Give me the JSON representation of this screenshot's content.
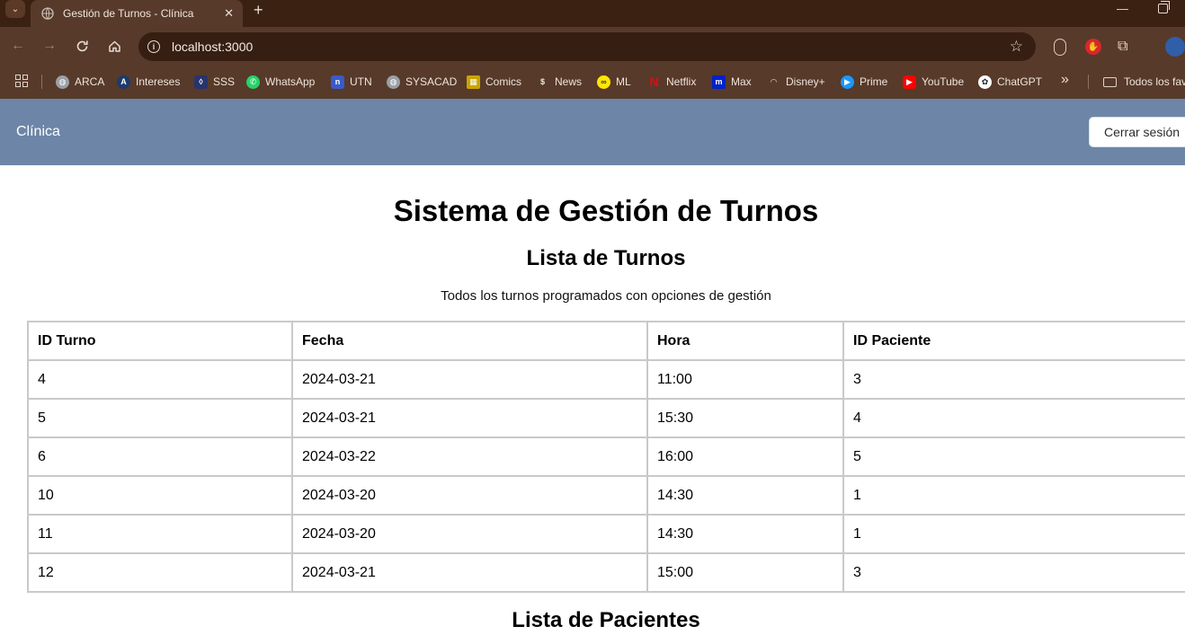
{
  "browser": {
    "tab_title": "Gestión de Turnos - Clínica",
    "url": "localhost:3000",
    "bookmarks": [
      {
        "label": "ARCA",
        "icon": "globe-icon",
        "color": "#9aa0a6"
      },
      {
        "label": "Intereses",
        "icon": "a-logo-icon",
        "color": "#1d3a6e"
      },
      {
        "label": "SSS",
        "icon": "sss-shield-icon",
        "color": "#27346e"
      },
      {
        "label": "WhatsApp",
        "icon": "whatsapp-icon",
        "color": "#25d366"
      },
      {
        "label": "UTN",
        "icon": "utn-icon",
        "color": "#3a5bc7"
      },
      {
        "label": "SYSACAD",
        "icon": "globe-icon",
        "color": "#9aa0a6"
      },
      {
        "label": "Comics",
        "icon": "comics-icon",
        "color": "#c9a400"
      },
      {
        "label": "News",
        "icon": "news-icon",
        "color": "#5a3a2a"
      },
      {
        "label": "ML",
        "icon": "mercadolibre-icon",
        "color": "#ffe600"
      },
      {
        "label": "Netflix",
        "icon": "netflix-icon",
        "color": "#e50914"
      },
      {
        "label": "Max",
        "icon": "max-icon",
        "color": "#0022c8"
      },
      {
        "label": "Disney+",
        "icon": "disney-icon",
        "color": "#573a2a"
      },
      {
        "label": "Prime",
        "icon": "prime-icon",
        "color": "#1a98ff"
      },
      {
        "label": "YouTube",
        "icon": "youtube-icon",
        "color": "#ff0000"
      },
      {
        "label": "ChatGPT",
        "icon": "chatgpt-icon",
        "color": "#ffffff"
      }
    ],
    "more_bookmarks": "»",
    "all_favorites": "Todos los favoritos"
  },
  "navbar": {
    "brand": "Clínica",
    "logout_label": "Cerrar sesión"
  },
  "main": {
    "title": "Sistema de Gestión de Turnos",
    "turnos_heading": "Lista de Turnos",
    "turnos_subtitle": "Todos los turnos programados con opciones de gestión",
    "table": {
      "headers": [
        "ID Turno",
        "Fecha",
        "Hora",
        "ID Paciente"
      ],
      "rows": [
        [
          "4",
          "2024-03-21",
          "11:00",
          "3"
        ],
        [
          "5",
          "2024-03-21",
          "15:30",
          "4"
        ],
        [
          "6",
          "2024-03-22",
          "16:00",
          "5"
        ],
        [
          "10",
          "2024-03-20",
          "14:30",
          "1"
        ],
        [
          "11",
          "2024-03-20",
          "14:30",
          "1"
        ],
        [
          "12",
          "2024-03-21",
          "15:00",
          "3"
        ]
      ]
    },
    "pacientes_heading": "Lista de Pacientes"
  },
  "colors": {
    "navbar_bg": "#6d86a7",
    "browser_frame": "#573a2a",
    "tabstrip": "#3b2112",
    "table_border": "#c9c9c9"
  }
}
